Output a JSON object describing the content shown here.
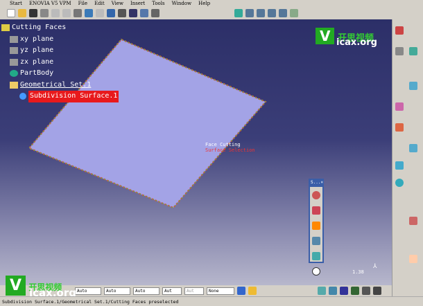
{
  "menu": [
    "Start",
    "ENOVIA V5 VPM",
    "File",
    "Edit",
    "View",
    "Insert",
    "Tools",
    "Window",
    "Help"
  ],
  "tree": {
    "root": "Cutting Faces",
    "items": [
      "xy plane",
      "yz plane",
      "zx plane",
      "PartBody"
    ],
    "geoset": "Geometrical Set.1",
    "selected": "Subdivision Surface.1"
  },
  "tooltip": {
    "line1": "Face Cutting",
    "line2": "Surface Selection"
  },
  "floating_toolbar": {
    "title": "S..."
  },
  "scale": "1.38",
  "bottom_selects": [
    "Auto",
    "Auto",
    "Auto",
    "Aut",
    "Aut",
    "None"
  ],
  "status": "Subdivision Surface.1/Geometrical Set.1/Cutting Faces preselected",
  "watermark": {
    "cn": "开思视频",
    "url": "icax.org"
  },
  "colors": {
    "selection": "#e8191c",
    "plane": "#a3a3e6"
  }
}
